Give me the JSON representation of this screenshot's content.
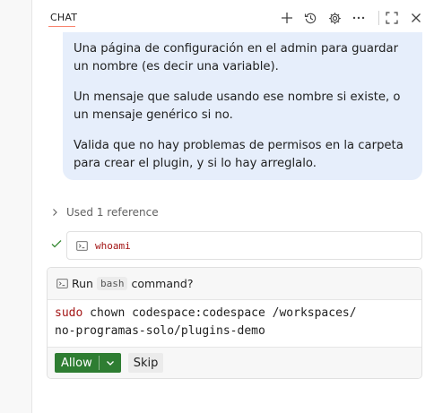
{
  "header": {
    "tab_label": "CHAT",
    "icons": [
      "plus-icon",
      "history-icon",
      "settings-gear-icon",
      "more-ellipsis-icon",
      "maximize-icon",
      "close-icon"
    ]
  },
  "message": {
    "paragraphs": [
      "Una página de configuración en el admin para guardar un nombre (es decir una variable).",
      "Un mensaje que salude usando ese nombre si existe, o un mensaje genérico si no.",
      "Valida que no hay problemas de permisos en la carpeta para crear el plugin, y si lo hay arreglalo."
    ]
  },
  "references": {
    "label": "Used 1 reference"
  },
  "terminal_result": {
    "command": "whoami"
  },
  "run_prompt": {
    "prefix": "Run",
    "shell": "bash",
    "suffix": "command?",
    "command_keyword": "sudo",
    "command_line1_rest": " chown codespace:codespace /workspaces/",
    "command_line2": "no-programas-solo/plugins-demo",
    "allow_label": "Allow",
    "skip_label": "Skip"
  },
  "colors": {
    "bubble_bg": "#e6eefb",
    "allow_green": "#2e7d32",
    "command_keyword": "#a31515",
    "tab_accent": "#f9826c"
  }
}
